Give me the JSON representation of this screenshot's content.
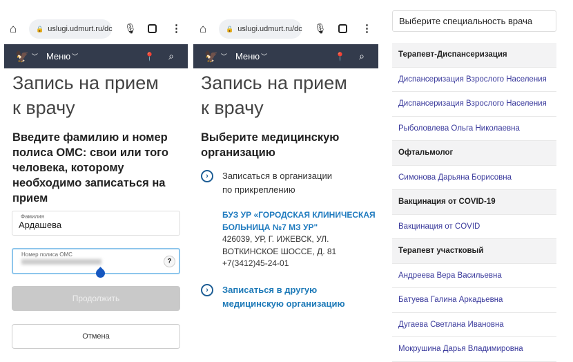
{
  "browser": {
    "url": "uslugi.udmurt.ru/dc"
  },
  "nav": {
    "menu_label": "Меню"
  },
  "panel1": {
    "title_line1": "Запись на прием",
    "title_line2": "к врачу",
    "instructions": [
      "Введите фамилию и номер",
      "полиса ОМС: свои или того",
      "человека, которому",
      "необходимо записаться на",
      "прием"
    ],
    "surname_label": "Фамилия",
    "surname_value": "Ардашева",
    "policy_label": "Номер полиса ОМС",
    "help": "?",
    "continue_label": "Продолжить",
    "cancel_label": "Отмена"
  },
  "panel2": {
    "title_line1": "Запись на прием",
    "title_line2": "к врачу",
    "subtitle": [
      "Выберите медицинскую",
      "организацию"
    ],
    "option1": [
      "Записаться в организации",
      "по прикреплению"
    ],
    "org_name": [
      "БУЗ УР «ГОРОДСКАЯ КЛИНИЧЕСКАЯ",
      "БОЛЬНИЦА №7 МЗ УР\""
    ],
    "org_address": [
      "426039, УР, Г. ИЖЕВСК, УЛ.",
      "ВОТКИНСКОЕ ШОССЕ, Д. 81",
      "+7(3412)45-24-01"
    ],
    "option2": [
      "Записаться в другую",
      "медицинскую организацию"
    ]
  },
  "panel3": {
    "select_placeholder": "Выберите специальность врача",
    "rows": [
      {
        "type": "header",
        "text": "Терапевт-Диспансеризация"
      },
      {
        "type": "link",
        "text": "Диспансеризация Взрослого Населения"
      },
      {
        "type": "link",
        "text": "Диспансеризация Взрослого Населения"
      },
      {
        "type": "link",
        "text": "Рыболовлева Ольга Николаевна"
      },
      {
        "type": "header",
        "text": "Офтальмолог"
      },
      {
        "type": "link",
        "text": "Симонова Дарьяна Борисовна"
      },
      {
        "type": "header",
        "text": "Вакцинация от COVID-19"
      },
      {
        "type": "link",
        "text": "Вакцинация от COVID"
      },
      {
        "type": "header",
        "text": "Терапевт участковый"
      },
      {
        "type": "link",
        "text": "Андреева Вера Васильевна"
      },
      {
        "type": "link",
        "text": "Батуева Галина Аркадьевна"
      },
      {
        "type": "link",
        "text": "Дугаева Светлана Ивановна"
      },
      {
        "type": "link",
        "text": "Мокрушина Дарья Владимировна"
      }
    ]
  }
}
